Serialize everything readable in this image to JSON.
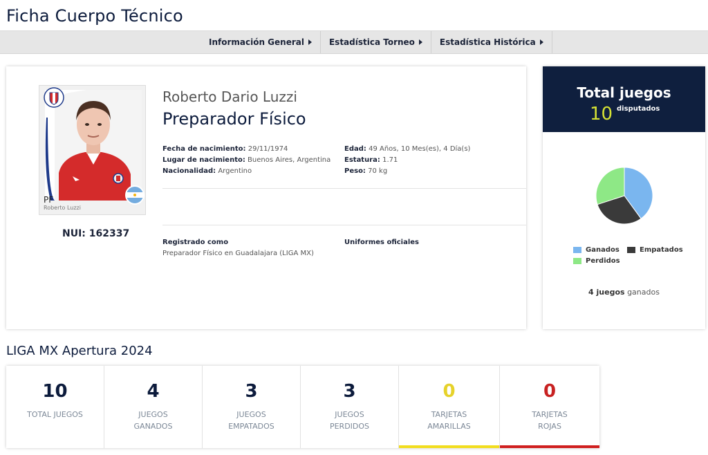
{
  "page_title": "Ficha Cuerpo Técnico",
  "tabs": [
    {
      "label": "Información General"
    },
    {
      "label": "Estadística Torneo"
    },
    {
      "label": "Estadística Histórica"
    }
  ],
  "profile": {
    "photo_position": "PF",
    "photo_caption": "Roberto Luzzi",
    "nui_label": "NUI: 162337",
    "full_name": "Roberto Dario Luzzi",
    "role": "Preparador Físico",
    "details_left": [
      {
        "label": "Fecha de nacimiento:",
        "value": "29/11/1974"
      },
      {
        "label": "Lugar de nacimiento:",
        "value": "Buenos Aires, Argentina"
      },
      {
        "label": "Nacionalidad:",
        "value": "Argentino"
      }
    ],
    "details_right": [
      {
        "label": "Edad:",
        "value": "49 Años, 10 Mes(es), 4 Día(s)"
      },
      {
        "label": "Estatura:",
        "value": "1.71"
      },
      {
        "label": "Peso:",
        "value": "70 kg"
      }
    ],
    "registered_title": "Registrado como",
    "registered_value": "Preparador Físico en Guadalajara (LIGA MX)",
    "uniforms_title": "Uniformes oficiales"
  },
  "totals": {
    "title": "Total juegos",
    "number": "10",
    "subtitle": "disputados",
    "legend": [
      {
        "label": "Ganados",
        "color": "#7ab6ef"
      },
      {
        "label": "Empatados",
        "color": "#3a3a3a"
      },
      {
        "label": "Perdidos",
        "color": "#8ee886"
      }
    ],
    "won_count": "4 juegos",
    "won_suffix": "ganados",
    "colors": {
      "header_bg": "#0f1f3e",
      "number": "#d5e134"
    }
  },
  "chart_data": {
    "type": "pie",
    "categories": [
      "Ganados",
      "Empatados",
      "Perdidos"
    ],
    "values": [
      4,
      3,
      3
    ],
    "colors": [
      "#7ab6ef",
      "#3a3a3a",
      "#8ee886"
    ],
    "legend_position": "bottom"
  },
  "season": {
    "title": "LIGA MX Apertura 2024",
    "stats": [
      {
        "value": "10",
        "label1": "TOTAL JUEGOS",
        "label2": "",
        "color": "#0c1b3c",
        "bar": ""
      },
      {
        "value": "4",
        "label1": "JUEGOS",
        "label2": "GANADOS",
        "color": "#0c1b3c",
        "bar": ""
      },
      {
        "value": "3",
        "label1": "JUEGOS",
        "label2": "EMPATADOS",
        "color": "#0c1b3c",
        "bar": ""
      },
      {
        "value": "3",
        "label1": "JUEGOS",
        "label2": "PERDIDOS",
        "color": "#0c1b3c",
        "bar": ""
      },
      {
        "value": "0",
        "label1": "TARJETAS",
        "label2": "AMARILLAS",
        "color": "#e6d22b",
        "bar": "#f2dd1e"
      },
      {
        "value": "0",
        "label1": "TARJETAS",
        "label2": "ROJAS",
        "color": "#c82222",
        "bar": "#d01f1f"
      }
    ]
  }
}
